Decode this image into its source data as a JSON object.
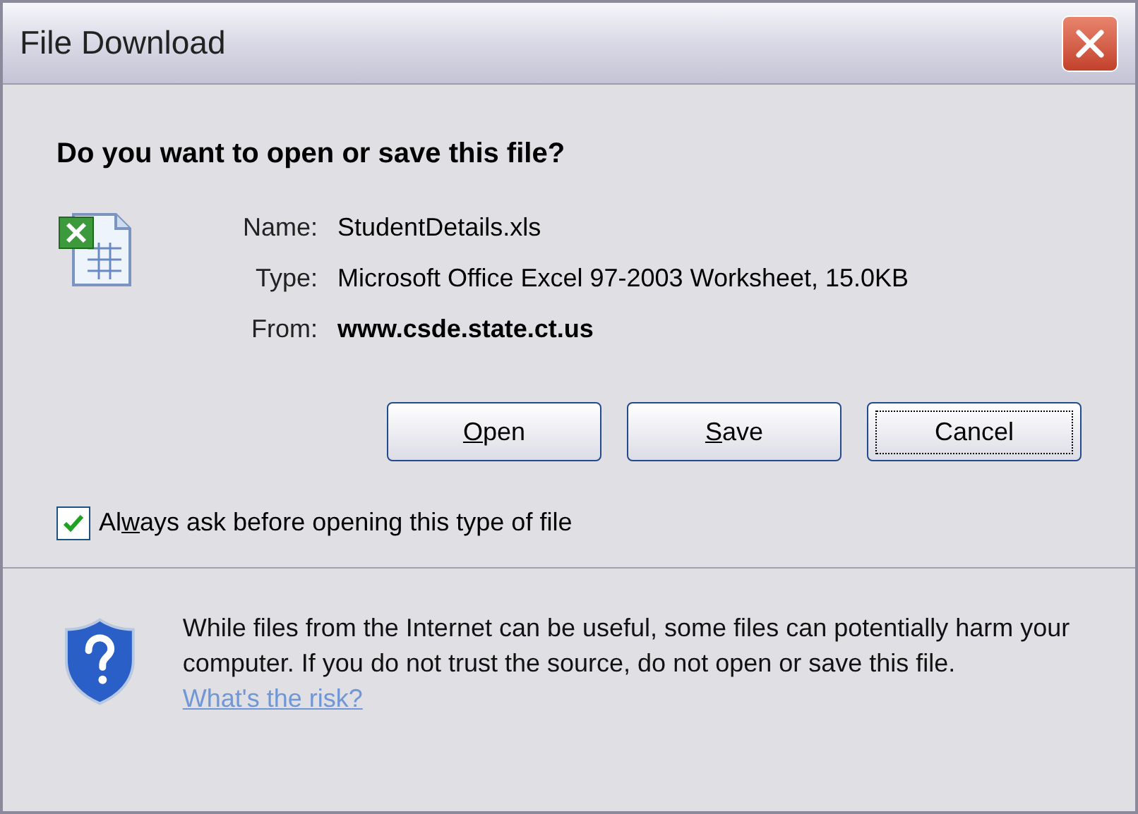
{
  "window": {
    "title": "File Download"
  },
  "question": "Do you want to open or save this file?",
  "details": [
    {
      "label": "Name:",
      "value": "StudentDetails.xls",
      "bold": false
    },
    {
      "label": "Type:",
      "value": "Microsoft Office Excel 97-2003 Worksheet, 15.0KB",
      "bold": false
    },
    {
      "label": "From:",
      "value": "www.csde.state.ct.us",
      "bold": true
    }
  ],
  "buttons": [
    {
      "key": "O",
      "after": "pen",
      "focused": false
    },
    {
      "key": "S",
      "after": "ave",
      "focused": false
    },
    {
      "before": "Cancel",
      "focused": true
    }
  ],
  "always_ask": {
    "before": "Al",
    "key": "w",
    "after": "ays ask before opening this type of file",
    "checked": true
  },
  "warning": {
    "text": "While files from the Internet can be useful, some files can potentially harm your computer. If you do not trust the source, do not open or save this file.",
    "link": "What's the risk?"
  }
}
